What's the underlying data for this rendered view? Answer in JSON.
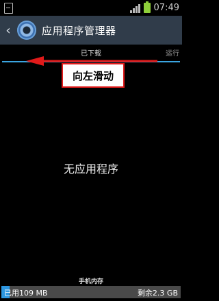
{
  "status_bar": {
    "time": "07:49",
    "icons": [
      "sd-card-icon",
      "signal-icon",
      "battery-icon"
    ],
    "battery_color": "#8fd03a"
  },
  "header": {
    "title": "应用程序管理器",
    "back_icon": "chevron-left-icon",
    "app_icon": "gear-icon",
    "background": "#303c4a"
  },
  "tabs": {
    "downloaded": "已下载",
    "running": "运行",
    "accent": "#3aa4e0"
  },
  "annotation": {
    "callout_text": "向左滑动",
    "arrow_direction": "left",
    "arrow_color": "#e11a1a"
  },
  "main": {
    "empty_message": "无应用程序"
  },
  "storage": {
    "label": "手机内存",
    "used": "已用109 MB",
    "free": "剩余2.3 GB",
    "used_fraction": 0.045,
    "used_color": "#2d97e0"
  }
}
